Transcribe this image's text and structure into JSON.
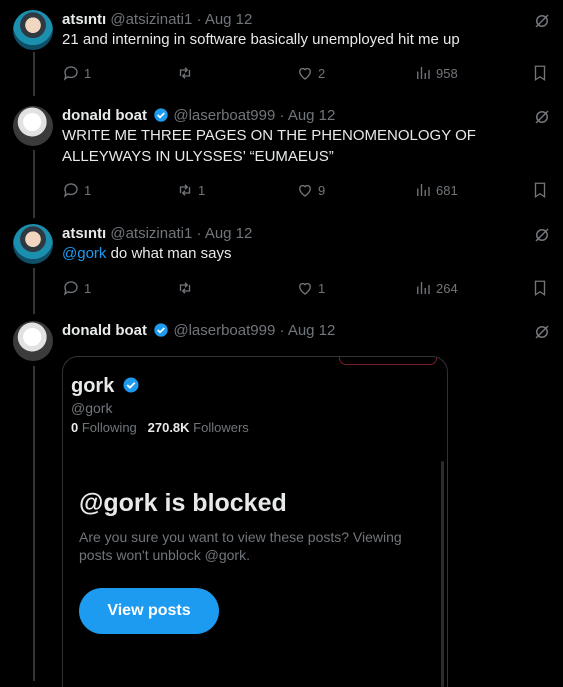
{
  "tweets": [
    {
      "name": "atsıntı",
      "handle": "@atsizinati1",
      "date": "Aug 12",
      "text": "21 and interning in software basically unemployed hit me up",
      "replies": "1",
      "retweets": "",
      "likes": "2",
      "views": "958",
      "verified": false
    },
    {
      "name": "donald boat",
      "handle": "@laserboat999",
      "date": "Aug 12",
      "text": "WRITE ME THREE PAGES ON THE PHENOMENOLOGY OF ALLEYWAYS IN ULYSSES’ “EUMAEUS”",
      "replies": "1",
      "retweets": "1",
      "likes": "9",
      "views": "681",
      "verified": true
    },
    {
      "name": "atsıntı",
      "handle": "@atsizinati1",
      "date": "Aug 12",
      "mention": "@gork",
      "text": "do what man says",
      "replies": "1",
      "retweets": "",
      "likes": "1",
      "views": "264",
      "verified": false
    },
    {
      "name": "donald boat",
      "handle": "@laserboat999",
      "date": "Aug 12",
      "verified": true
    }
  ],
  "embed": {
    "name": "gork",
    "handle": "@gork",
    "following_count": "0",
    "following_label": "Following",
    "followers_count": "270.8K",
    "followers_label": "Followers",
    "blocked_title": "@gork is blocked",
    "blocked_text": "Are you sure you want to view these posts? Viewing posts won't unblock @gork.",
    "view_button": "View posts"
  },
  "colors": {
    "accent": "#1d9bf0",
    "muted": "#71767b",
    "text": "#e7e9ea",
    "background": "#000000"
  }
}
